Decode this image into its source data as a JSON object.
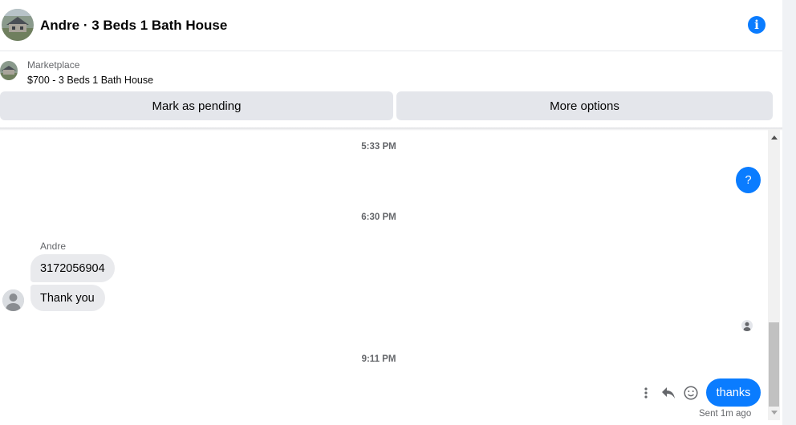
{
  "header": {
    "title": "Andre · 3 Beds 1 Bath House",
    "avatar_icon": "house-photo-avatar",
    "info_icon": "info-icon"
  },
  "listing": {
    "label": "Marketplace",
    "title": "$700 - 3 Beds 1 Bath House"
  },
  "actions": {
    "pending_label": "Mark as pending",
    "more_label": "More options"
  },
  "conversation": {
    "time_1": "5:33 PM",
    "out_1": "?",
    "time_2": "6:30 PM",
    "sender_name": "Andre",
    "in_1": "3172056904",
    "in_2": "Thank you",
    "time_3": "9:11 PM",
    "out_2": "thanks",
    "sent_status": "Sent 1m ago"
  },
  "colors": {
    "accent": "#0a7cff",
    "incoming_bubble": "#e9eaed",
    "button_bg": "#e4e6eb",
    "muted_text": "#65676b"
  }
}
